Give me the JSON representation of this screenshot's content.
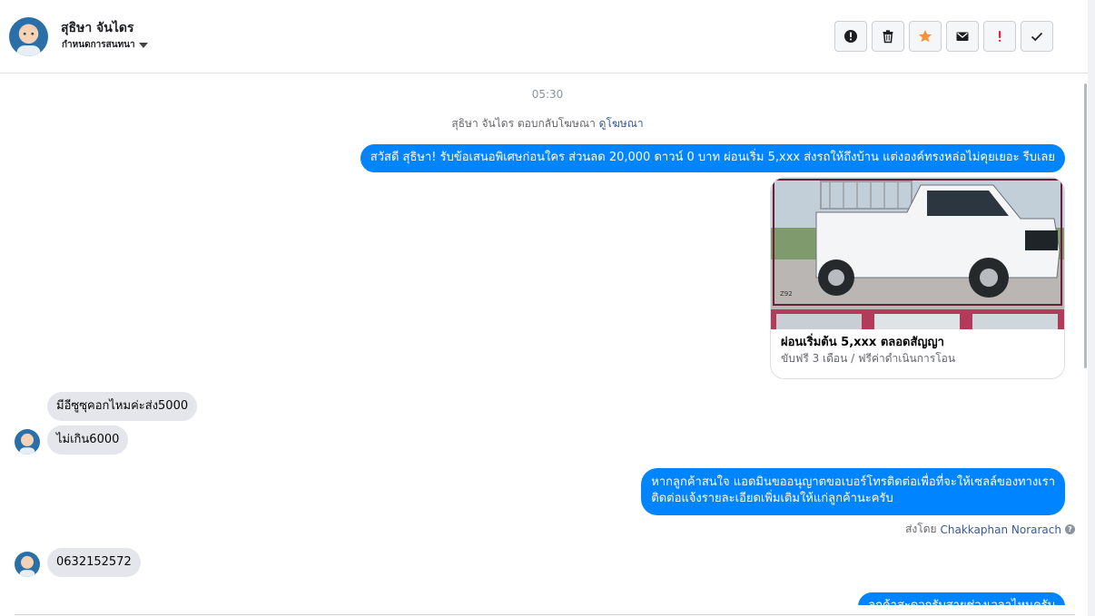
{
  "header": {
    "contact_name": "สุธิษา จันไดร",
    "assign_label": "กำหนดการสนทนา"
  },
  "toolbar": {
    "buttons": [
      {
        "icon": "exclamation-circle-icon"
      },
      {
        "icon": "trash-icon"
      },
      {
        "icon": "star-icon",
        "color": "#f7923a"
      },
      {
        "icon": "envelope-icon"
      },
      {
        "icon": "exclamation-icon",
        "color": "#e41e3f"
      },
      {
        "icon": "check-icon"
      }
    ]
  },
  "conversation": {
    "timestamp": "05:30",
    "reply_note_prefix": "สุธิษา จันไดร ตอบกลับโฆษณา",
    "reply_note_link": "ดูโฆษณา",
    "messages": [
      {
        "from": "page",
        "text": "สวัสดี สุธิษา! รับข้อเสนอพิเศษก่อนใคร ส่วนลด 20,000 ดาวน์ 0 บาท ผ่อนเริ่ม 5,xxx ส่งรถให้ถึงบ้าน แต่งองค์ทรงหล่อไม่คุยเยอะ รีบเลย"
      },
      {
        "from": "page",
        "type": "card",
        "image_label": "Z92",
        "title": "ผ่อนเริ่มต้น 5,xxx ตลอดสัญญา",
        "subtitle": "ขับฟรี 3 เดือน / ฟรีค่าดำเนินการโอน"
      },
      {
        "from": "customer",
        "text": "มีอีซูซุคอกไหมค่ะส่ง5000"
      },
      {
        "from": "customer",
        "text": "ไม่เกิน6000"
      },
      {
        "from": "page",
        "text_line1": "หากลูกค้าสนใจ แอดมินขออนุญาตขอเบอร์โทรติดต่อเพื่อที่จะให้เซลล์ของทางเรา",
        "text_line2": "ติดต่อแจ้งรายละเอียดเพิ่มเติมให้แก่ลูกค้านะครับ"
      },
      {
        "from": "customer",
        "text": "0632152572"
      },
      {
        "from": "page",
        "text": "ลูกค้าสะดวกรับสายช่วงเวลาไหนครับ"
      }
    ],
    "sent_by_prefix": "ส่งโดย",
    "sent_by_name": "Chakkaphan Norarach"
  },
  "colors": {
    "outgoing_bubble": "#0084ff",
    "incoming_bubble": "#e4e6eb",
    "link": "#385898"
  }
}
